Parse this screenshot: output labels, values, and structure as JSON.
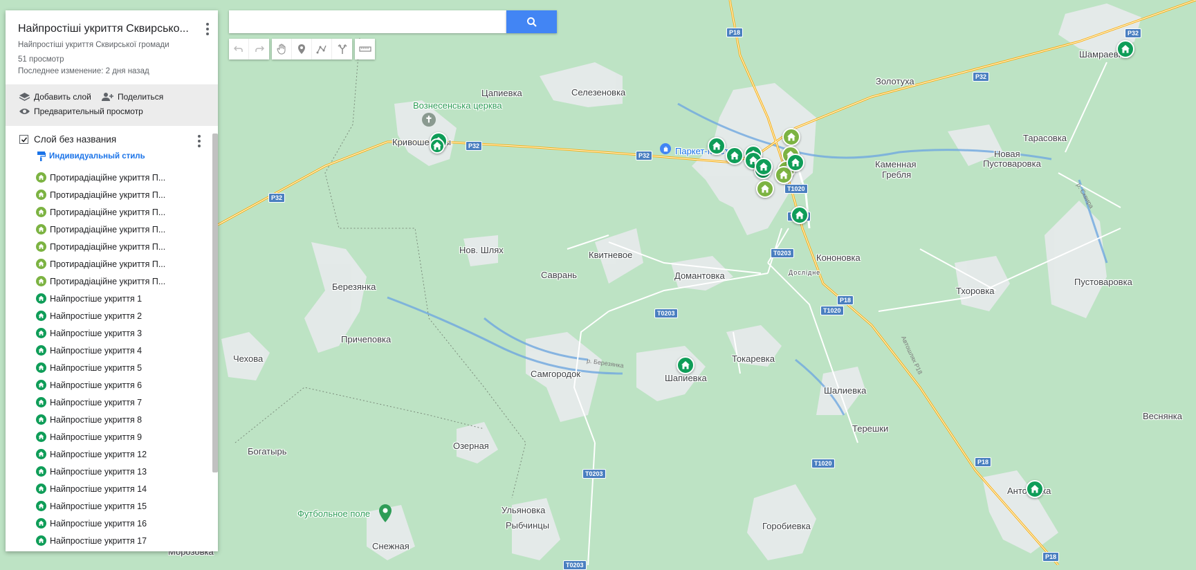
{
  "search": {
    "placeholder": ""
  },
  "toolbar": {
    "icons": [
      "undo-icon",
      "redo-icon",
      "hand-icon",
      "marker-icon",
      "polyline-icon",
      "directions-icon",
      "ruler-icon"
    ]
  },
  "panel": {
    "title": "Найпростіші укриття Сквирсько...",
    "description": "Найпростіші укриття Сквирської громади",
    "views": "51 просмотр",
    "modified": "Последнее изменение: 2 дня назад",
    "add_layer": "Добавить слой",
    "share": "Поделиться",
    "preview": "Предварительный просмотр",
    "layer_title": "Слой без названия",
    "style_label": "Индивидуальный стиль"
  },
  "items": [
    {
      "label": "Протирадіаційне укриття П...",
      "color": "#7cb342"
    },
    {
      "label": "Протирадіаційне укриття П...",
      "color": "#7cb342"
    },
    {
      "label": "Протирадіаційне укриття П...",
      "color": "#7cb342"
    },
    {
      "label": "Протирадіаційне укриття П...",
      "color": "#7cb342"
    },
    {
      "label": "Протирадіаційне укриття П...",
      "color": "#7cb342"
    },
    {
      "label": "Протирадіаційне укриття П...",
      "color": "#7cb342"
    },
    {
      "label": "Протирадіаційне укриття П...",
      "color": "#7cb342"
    },
    {
      "label": "Найпростіше укриття 1",
      "color": "#0f9d58"
    },
    {
      "label": "Найпростіше укриття 2",
      "color": "#0f9d58"
    },
    {
      "label": "Найпростіше укриття 3",
      "color": "#0f9d58"
    },
    {
      "label": "Найпростіше укриття 4",
      "color": "#0f9d58"
    },
    {
      "label": "Найпростіше укриття 5",
      "color": "#0f9d58"
    },
    {
      "label": "Найпростіше укриття 6",
      "color": "#0f9d58"
    },
    {
      "label": "Найпростіше укриття 7",
      "color": "#0f9d58"
    },
    {
      "label": "Найпростіше укриття 8",
      "color": "#0f9d58"
    },
    {
      "label": "Найпростіше укриття 9",
      "color": "#0f9d58"
    },
    {
      "label": "Найпростіше укриття 12",
      "color": "#0f9d58"
    },
    {
      "label": "Найпростіше укриття 13",
      "color": "#0f9d58"
    },
    {
      "label": "Найпростіше укриття 14",
      "color": "#0f9d58"
    },
    {
      "label": "Найпростіше укриття 15",
      "color": "#0f9d58"
    },
    {
      "label": "Найпростіше укриття 16",
      "color": "#0f9d58"
    },
    {
      "label": "Найпростіше укриття 17",
      "color": "#0f9d58"
    }
  ],
  "map": {
    "places": [
      "Цапиевка",
      "Селезеновка",
      "Кривошеинцы",
      "Золотуха",
      "Шамраевка",
      "Тарасовка",
      "Новая",
      "Пустоваровка",
      "Каменная",
      "Гребля",
      "Нов. Шлях",
      "Квитневое",
      "Саврань",
      "Домантовка",
      "Кононовка",
      "Березянка",
      "Тхоровка",
      "Пустоваровка",
      "Причеповка",
      "Чехова",
      "Самгородок",
      "Шапиевка",
      "Токаревка",
      "Шалиевка",
      "Терешки",
      "Веснянка",
      "Богатырь",
      "Озерная",
      "Антоновка",
      "Ульяновка",
      "Рыбчинцы",
      "Горобиевка",
      "Снежная",
      "Морозовка",
      "Дослідне"
    ],
    "pois": [
      "Вознесенська церква",
      "Паркет-Мастер",
      "Футбольное поле"
    ],
    "shields": [
      "P18",
      "P32",
      "P32",
      "P32",
      "P32",
      "P32",
      "T1020",
      "T1020",
      "T0203",
      "P18",
      "T1020",
      "T0203",
      "T0203",
      "T1020",
      "P18",
      "P18",
      "T0203"
    ],
    "road_texts": [
      "р. Березянка",
      "Автошлях P18",
      "р. Сквира"
    ]
  }
}
